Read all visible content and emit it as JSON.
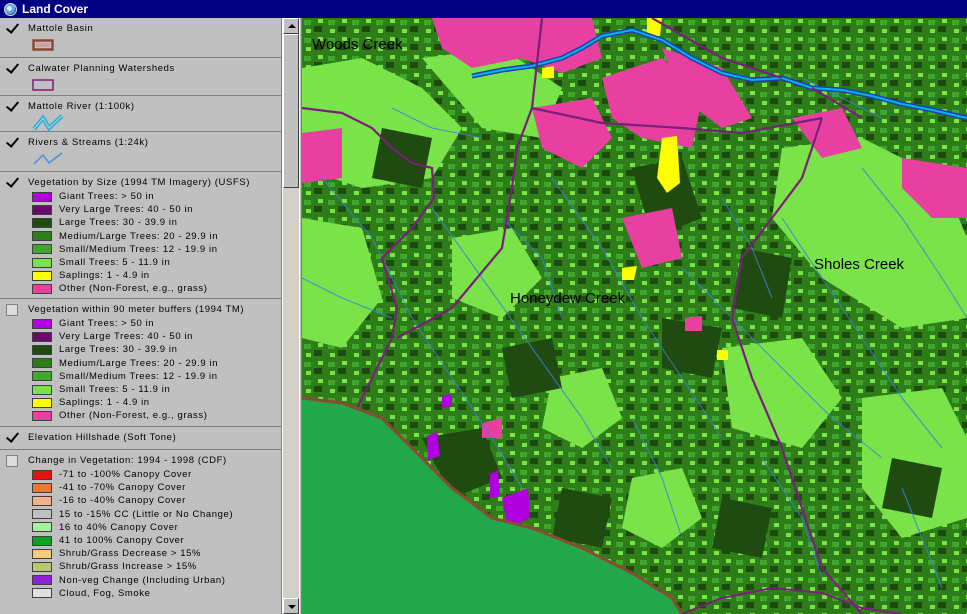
{
  "window": {
    "title": "Land Cover",
    "icon": "globe-icon"
  },
  "legend": {
    "layers": [
      {
        "name": "Mattole Basin",
        "checked": true,
        "symbol": "polygon-outline",
        "color": "#8b4a32"
      },
      {
        "name": "Calwater Planning Watersheds",
        "checked": true,
        "symbol": "polygon-outline",
        "color": "#7a1f7a"
      },
      {
        "name": "Mattole River (1:100k)",
        "checked": true,
        "symbol": "double-line",
        "color": "#00b4e6"
      },
      {
        "name": "Rivers & Streams (1:24k)",
        "checked": true,
        "symbol": "line",
        "color": "#4f8fd8"
      },
      {
        "name": "Vegetation by Size (1994 TM Imagery) (USFS)",
        "checked": true,
        "symbol": "classes",
        "classes": [
          {
            "label": "Giant Trees: > 50 in",
            "color": "#b000e0"
          },
          {
            "label": "Very Large Trees: 40 - 50 in",
            "color": "#6a0a6a"
          },
          {
            "label": "Large Trees: 30 - 39.9 in",
            "color": "#1f4a10"
          },
          {
            "label": "Medium/Large Trees: 20 - 29.9 in",
            "color": "#2e7d1a"
          },
          {
            "label": "Small/Medium Trees: 12 - 19.9 in",
            "color": "#3fa82a"
          },
          {
            "label": "Small Trees: 5 - 11.9 in",
            "color": "#7be34a"
          },
          {
            "label": "Saplings: 1 - 4.9 in",
            "color": "#ffff00"
          },
          {
            "label": "Other (Non-Forest, e.g., grass)",
            "color": "#e840a0"
          }
        ]
      },
      {
        "name": "Vegetation within 90 meter buffers (1994 TM)",
        "checked": false,
        "symbol": "classes",
        "classes": [
          {
            "label": "Giant Trees: > 50 in",
            "color": "#b000e0"
          },
          {
            "label": "Very Large Trees: 40 - 50 in",
            "color": "#6a0a6a"
          },
          {
            "label": "Large Trees: 30 - 39.9 in",
            "color": "#1f4a10"
          },
          {
            "label": "Medium/Large Trees: 20 - 29.9 in",
            "color": "#2e7d1a"
          },
          {
            "label": "Small/Medium Trees: 12 - 19.9 in",
            "color": "#3fa82a"
          },
          {
            "label": "Small Trees: 5 - 11.9 in",
            "color": "#7be34a"
          },
          {
            "label": "Saplings: 1 - 4.9 in",
            "color": "#ffff00"
          },
          {
            "label": "Other (Non-Forest, e.g., grass)",
            "color": "#e840a0"
          }
        ]
      },
      {
        "name": "Elevation Hillshade (Soft Tone)",
        "checked": true,
        "symbol": "none"
      },
      {
        "name": "Change in Vegetation: 1994 - 1998 (CDF)",
        "checked": false,
        "symbol": "classes",
        "classes": [
          {
            "label": "-71 to -100% Canopy Cover",
            "color": "#e81010"
          },
          {
            "label": "-41 to -70% Canopy Cover",
            "color": "#f07830"
          },
          {
            "label": "-16 to -40% Canopy Cover",
            "color": "#f4b088"
          },
          {
            "label": "15 to -15% CC (Little or No Change)",
            "color": "#c0c0c0"
          },
          {
            "label": "16 to 40% Canopy Cover",
            "color": "#a8f0a0"
          },
          {
            "label": "41 to 100% Canopy Cover",
            "color": "#10a020"
          },
          {
            "label": "Shrub/Grass Decrease > 15%",
            "color": "#f4cc80"
          },
          {
            "label": "Shrub/Grass Increase > 15%",
            "color": "#b8c870"
          },
          {
            "label": "Non-veg Change (Including Urban)",
            "color": "#9020d8"
          },
          {
            "label": "Cloud, Fog, Smoke",
            "color": "#e0e0e0"
          }
        ]
      }
    ]
  },
  "map": {
    "labels": [
      "Woods Creek",
      "Honeydew Creek",
      "Sholes Creek"
    ],
    "colors": {
      "large_trees": "#1f4a10",
      "medium_large": "#2e7d1a",
      "small_medium": "#3fa82a",
      "small_trees": "#7be34a",
      "saplings": "#ffff00",
      "other": "#e840a0",
      "giant": "#b000e0",
      "ocean": "#22a84a",
      "streams": "#3d7fd8",
      "river": "#1f3fb0",
      "watershed": "#7a1f7a",
      "basin": "#8b4a32"
    }
  }
}
